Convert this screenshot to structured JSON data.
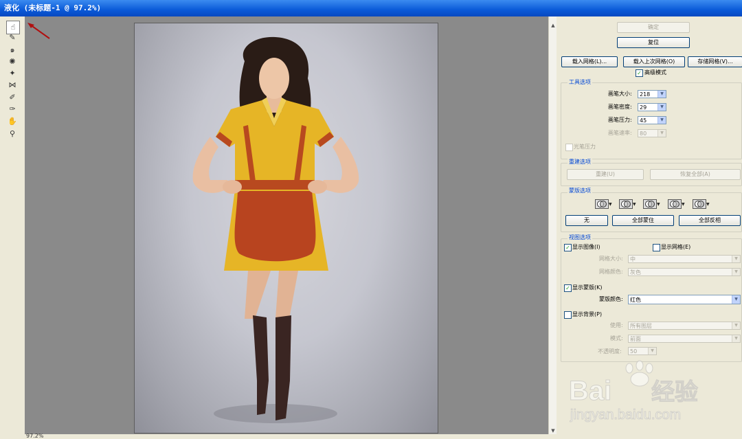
{
  "window": {
    "title": "液化 (未标题-1 @ 97.2%)"
  },
  "canvas": {
    "zoom": "97.2%"
  },
  "tools": [
    "forward-warp-icon",
    "reconstruct-icon",
    "twirl-icon",
    "pucker-icon",
    "bloat-icon",
    "push-left-icon",
    "freeze-mask-icon",
    "thaw-mask-icon",
    "hand-icon",
    "zoom-icon"
  ],
  "buttons": {
    "ok": "确定",
    "reset": "复位",
    "load_mesh": "载入网格(L)...",
    "load_last_mesh": "载入上次网格(O)",
    "save_mesh": "存储网格(V)...",
    "advanced_mode": "高级模式"
  },
  "tool_options": {
    "title": "工具选项",
    "brush_size_label": "画笔大小:",
    "brush_size": "218",
    "brush_density_label": "画笔密度:",
    "brush_density": "29",
    "brush_pressure_label": "画笔压力:",
    "brush_pressure": "45",
    "brush_rate_label": "画笔速率:",
    "brush_rate": "80",
    "stylus_pressure": "光笔压力"
  },
  "reconstruct_options": {
    "title": "重建选项",
    "reconstruct": "重建(U)",
    "restore_all": "恢复全部(A)"
  },
  "mask_options": {
    "title": "蒙版选项",
    "none": "无",
    "mask_all": "全部蒙住",
    "invert_all": "全部反相"
  },
  "view_options": {
    "title": "视图选项",
    "show_image": "显示图像(I)",
    "show_mesh": "显示网格(E)",
    "mesh_size_label": "网格大小:",
    "mesh_size": "中",
    "mesh_color_label": "网格颜色:",
    "mesh_color": "灰色",
    "show_mask": "显示蒙版(K)",
    "mask_color_label": "蒙版颜色:",
    "mask_color": "红色",
    "show_backdrop": "显示背景(P)",
    "use_label": "使用:",
    "use_value": "所有图层",
    "mode_label": "模式:",
    "mode_value": "前面",
    "opacity_label": "不透明度:",
    "opacity_value": "50"
  },
  "watermark": {
    "brand": "Baidu经验",
    "url": "jingyan.baidu.com"
  }
}
